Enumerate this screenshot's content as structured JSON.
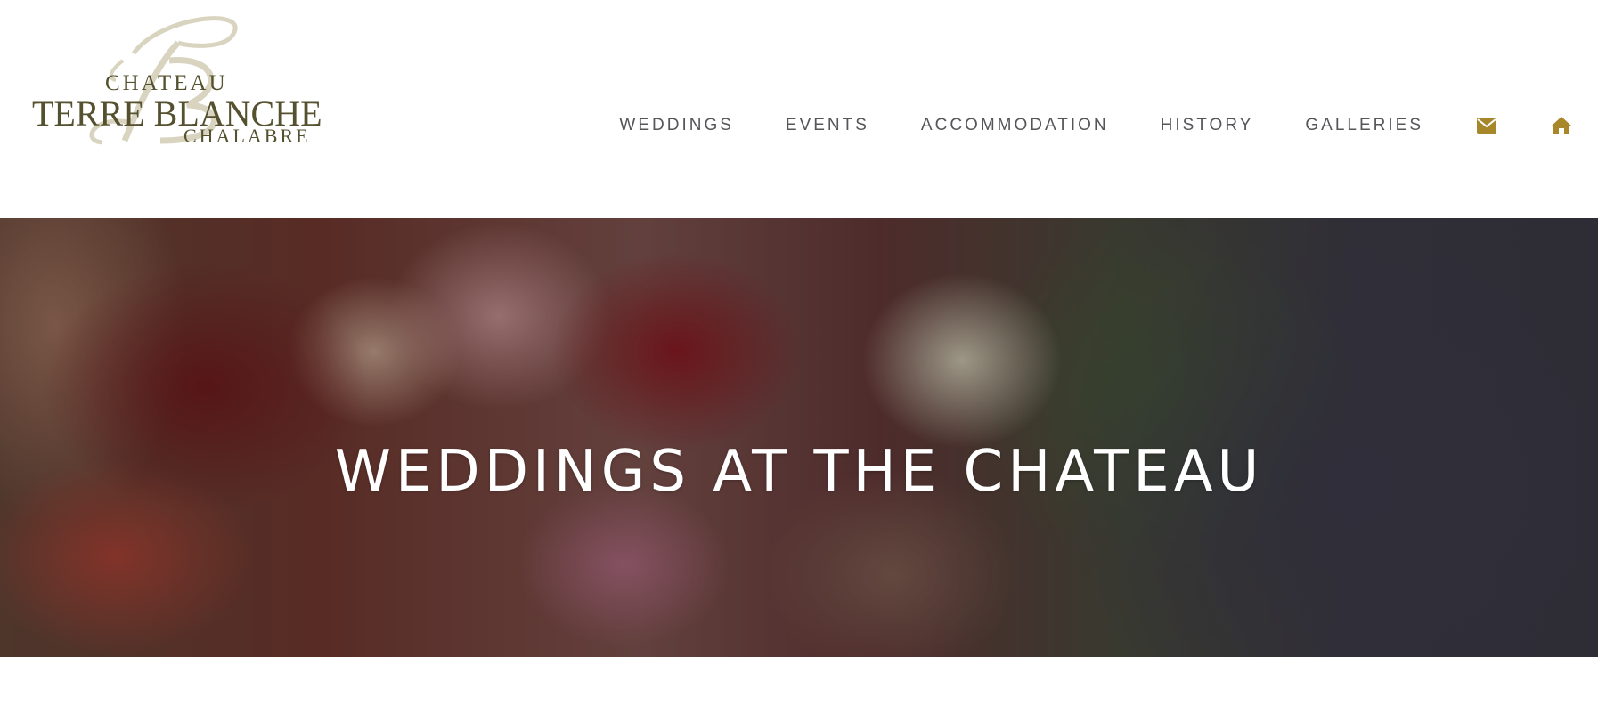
{
  "logo": {
    "line1": "CHATEAU",
    "line2": "TERRE BLANCHE",
    "line3": "CHALABRE",
    "monogram": "TB"
  },
  "nav": {
    "items": [
      {
        "label": "WEDDINGS"
      },
      {
        "label": "EVENTS"
      },
      {
        "label": "ACCOMMODATION"
      },
      {
        "label": "HISTORY"
      },
      {
        "label": "GALLERIES"
      }
    ],
    "icons": [
      {
        "name": "envelope-icon"
      },
      {
        "name": "home-icon"
      }
    ]
  },
  "hero": {
    "title": "WEDDINGS AT THE CHATEAU"
  },
  "colors": {
    "accent": "#a8872a",
    "logo_text": "#55512f",
    "logo_monogram": "#d8d4bf",
    "nav_text": "#55555a"
  }
}
